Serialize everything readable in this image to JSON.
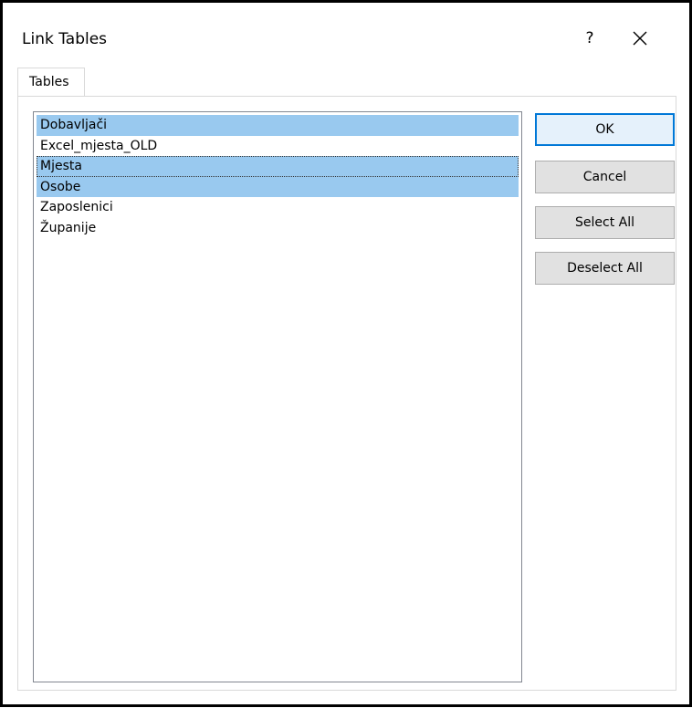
{
  "window": {
    "title": "Link Tables",
    "help_label": "?"
  },
  "tabs": [
    {
      "label": "Tables"
    }
  ],
  "tables_list": {
    "items": [
      {
        "label": "Dobavljači",
        "selected": true
      },
      {
        "label": "Excel_mjesta_OLD",
        "selected": false
      },
      {
        "label": "Mjesta",
        "selected": true,
        "focused": true
      },
      {
        "label": "Osobe",
        "selected": true
      },
      {
        "label": "Zaposlenici",
        "selected": false
      },
      {
        "label": "Županije",
        "selected": false
      }
    ]
  },
  "buttons": {
    "ok": "OK",
    "cancel": "Cancel",
    "select_all": "Select All",
    "deselect_all": "Deselect All"
  },
  "colors": {
    "selection": "#99c9ef",
    "default_button_border": "#0078d7"
  }
}
